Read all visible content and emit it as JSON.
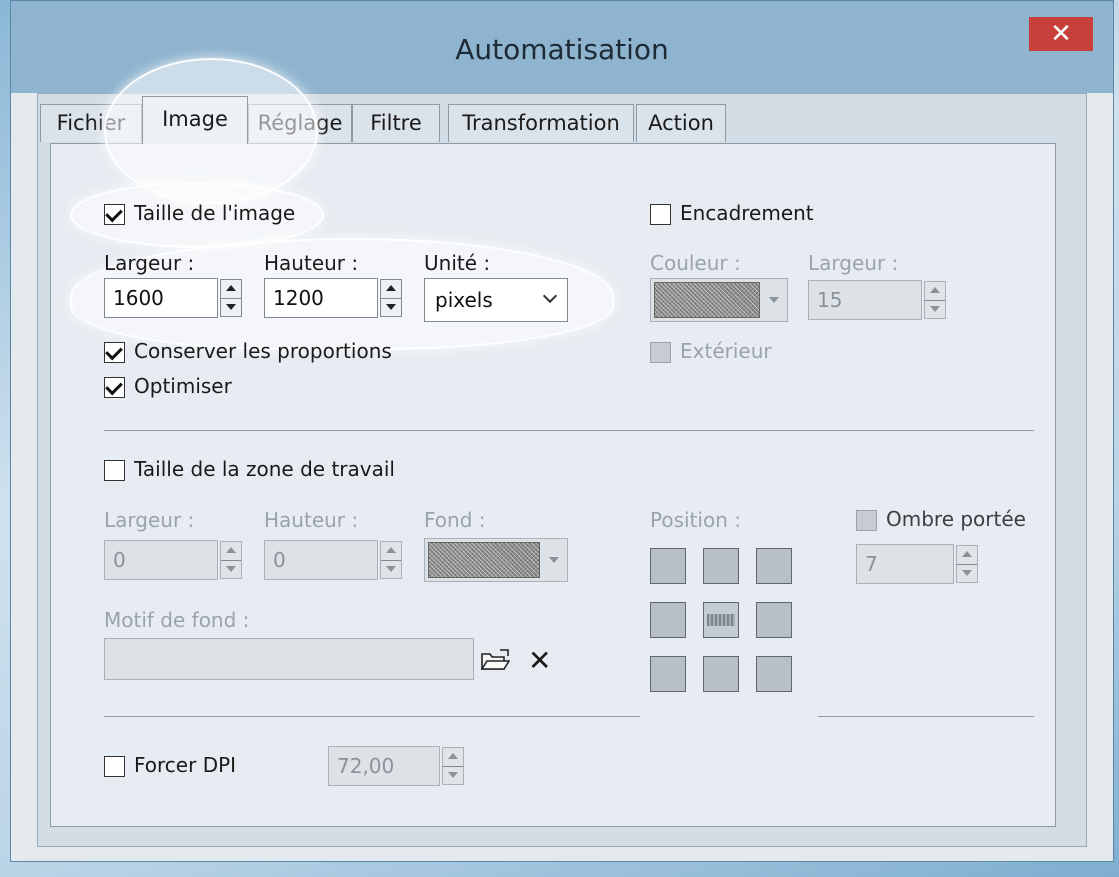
{
  "window": {
    "title": "Automatisation",
    "close_glyph": "✕"
  },
  "tabs": [
    {
      "label": "Fichier",
      "active": false
    },
    {
      "label": "Image",
      "active": true
    },
    {
      "label": "Réglage",
      "active": false
    },
    {
      "label": "Filtre",
      "active": false
    },
    {
      "label": "Transformation",
      "active": false
    },
    {
      "label": "Action",
      "active": false
    }
  ],
  "image_size": {
    "checkbox_label": "Taille de l'image",
    "checked": true,
    "width_label": "Largeur :",
    "width_value": "1600",
    "height_label": "Hauteur :",
    "height_value": "1200",
    "unit_label": "Unité :",
    "unit_value": "pixels",
    "keep_ratio_label": "Conserver les proportions",
    "keep_ratio_checked": true,
    "optimize_label": "Optimiser",
    "optimize_checked": true
  },
  "frame": {
    "checkbox_label": "Encadrement",
    "checked": false,
    "color_label": "Couleur :",
    "width_label": "Largeur :",
    "width_value": "15",
    "outside_label": "Extérieur",
    "outside_checked": false
  },
  "canvas_size": {
    "checkbox_label": "Taille de la zone de travail",
    "checked": false,
    "width_label": "Largeur :",
    "width_value": "0",
    "height_label": "Hauteur :",
    "height_value": "0",
    "background_label": "Fond :",
    "position_label": "Position :",
    "pattern_label": "Motif de fond :",
    "pattern_value": ""
  },
  "shadow": {
    "checkbox_label": "Ombre portée",
    "checked": false,
    "value": "7"
  },
  "dpi": {
    "checkbox_label": "Forcer DPI",
    "checked": false,
    "value": "72,00"
  },
  "icons": {
    "close": "close-icon",
    "browse": "folder-open-icon",
    "clear": "delete-x-icon",
    "dropdown": "chevron-down-icon",
    "spin": "spin-arrows-icon"
  }
}
